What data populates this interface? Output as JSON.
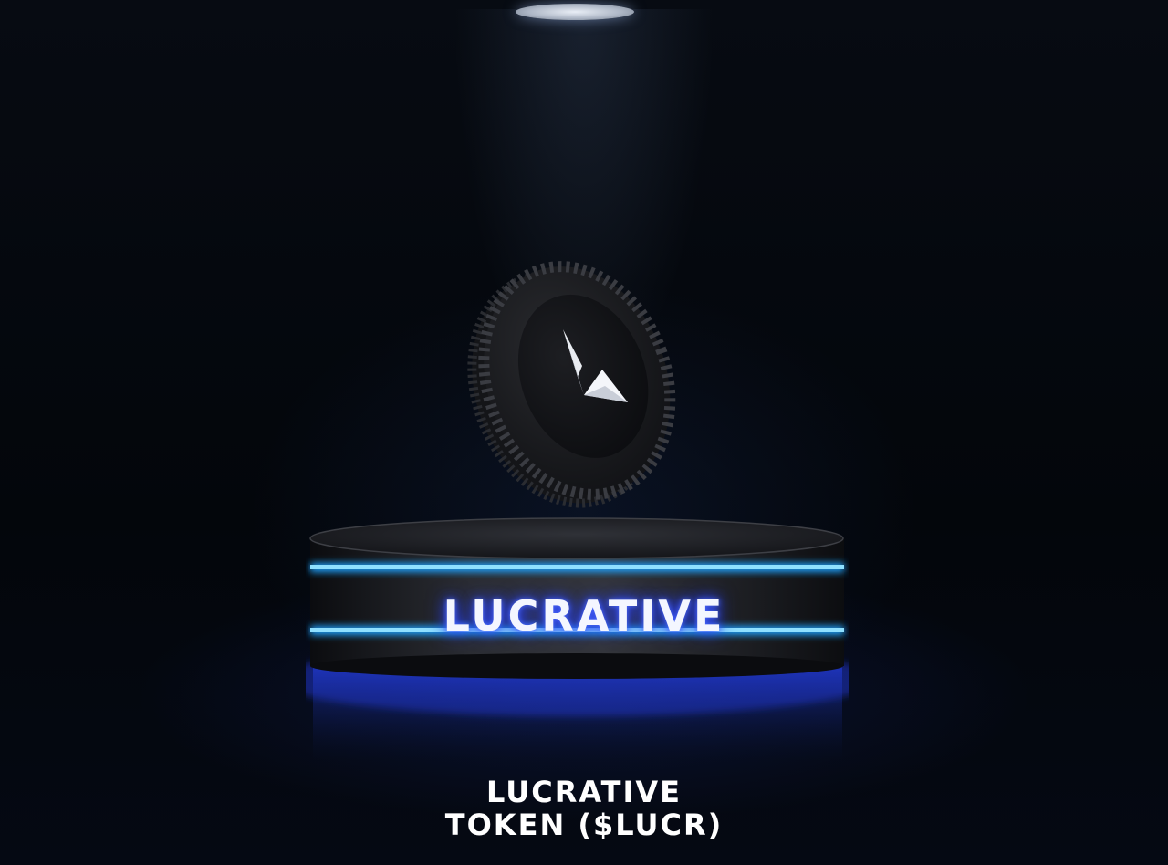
{
  "scene": {
    "podium_text": "LUCRATIVE",
    "caption_line1": "LUCRATIVE",
    "caption_line2": "TOKEN ($LUCR)"
  },
  "colors": {
    "background": "#04070d",
    "neon_blue": "#3ab4ff",
    "glow_blue": "#2d46ff",
    "text": "#ffffff"
  },
  "icons": {
    "coin": "lucrative-coin-icon",
    "logo": "lucrative-logo-icon"
  }
}
